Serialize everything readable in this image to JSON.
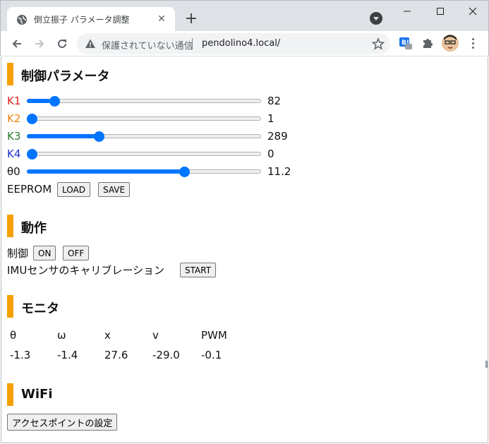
{
  "browser": {
    "tab_title": "倒立振子 パラメータ調整",
    "address_insecure_text": "保護されていない通信",
    "url": "pendolino4.local/",
    "icons": [
      "globe-icon",
      "close-icon",
      "plus-icon",
      "tab-search-icon",
      "minimize-icon",
      "maximize-icon",
      "window-close-icon",
      "back-arrow-icon",
      "forward-arrow-icon",
      "reload-icon",
      "warning-icon",
      "star-icon",
      "extension-b-icon",
      "puzzle-icon",
      "avatar",
      "menu-dots-icon"
    ]
  },
  "sections": {
    "control_params": "制御パラメータ",
    "operation": "動作",
    "monitor": "モニタ",
    "wifi": "WiFi"
  },
  "params": [
    {
      "name": "K1",
      "value": "82",
      "fraction": 0.1,
      "color": "#e0201a"
    },
    {
      "name": "K2",
      "value": "1",
      "fraction": 0.0,
      "color": "#f08010"
    },
    {
      "name": "K3",
      "value": "289",
      "fraction": 0.3,
      "color": "#2a7a2a"
    },
    {
      "name": "K4",
      "value": "0",
      "fraction": 0.0,
      "color": "#2030d0"
    },
    {
      "name": "θ0",
      "value": "11.2",
      "fraction": 0.68,
      "color": "#111111"
    }
  ],
  "eeprom": {
    "label": "EEPROM",
    "load_label": "LOAD",
    "save_label": "SAVE"
  },
  "operation": {
    "control_label": "制御",
    "on_label": "ON",
    "off_label": "OFF",
    "imu_label": "IMUセンサのキャリブレーション",
    "start_label": "START"
  },
  "monitor": {
    "headers": [
      "θ",
      "ω",
      "x",
      "v",
      "PWM"
    ],
    "values": [
      "-1.3",
      "-1.4",
      "27.6",
      "-29.0",
      "-0.1"
    ]
  },
  "wifi": {
    "ap_button_label": "アクセスポイントの設定"
  },
  "colors": {
    "accent_bar": "#f5a000",
    "slider": "#0075ff"
  }
}
